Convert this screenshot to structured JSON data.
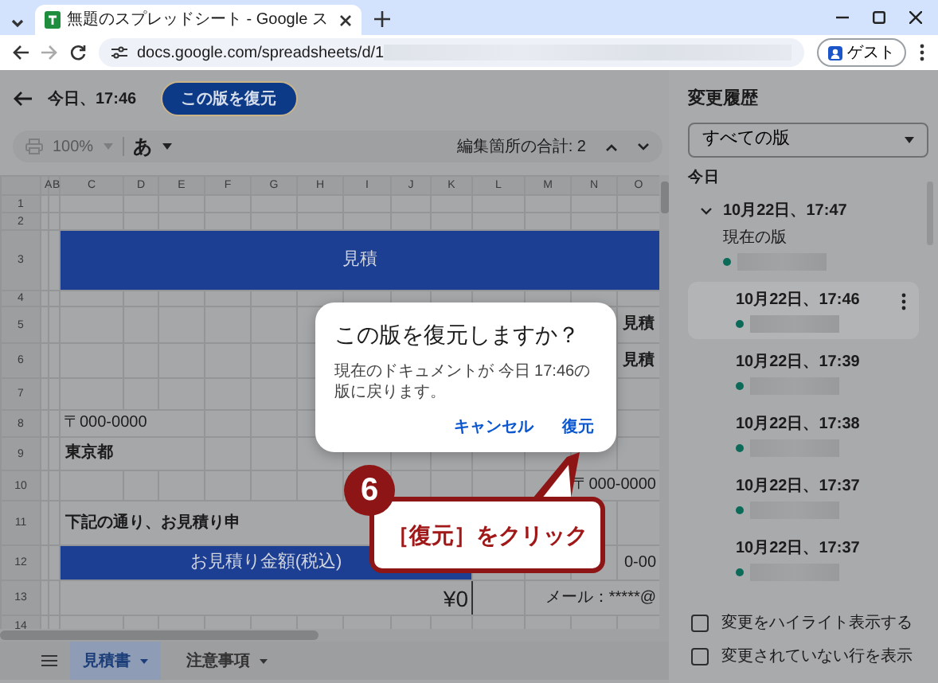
{
  "browser": {
    "tab_title": "無題のスプレッドシート - Google ス",
    "url": "docs.google.com/spreadsheets/d/1",
    "profile": "ゲスト"
  },
  "header": {
    "title": "今日、17:46",
    "restore_button": "この版を復元"
  },
  "toolbar": {
    "zoom": "100%",
    "input_mode": "あ",
    "edit_count": "編集箇所の合計: 2"
  },
  "sheet": {
    "columns": [
      "A",
      "B",
      "C",
      "D",
      "E",
      "F",
      "G",
      "H",
      "I",
      "J",
      "K",
      "L",
      "M",
      "N",
      "O"
    ],
    "rows": [
      {
        "number": "1"
      },
      {
        "number": "2"
      },
      {
        "number": "3",
        "cells": [
          {
            "kind": "banner",
            "text": "見積"
          }
        ]
      },
      {
        "number": "4"
      },
      {
        "number": "5",
        "cells": [
          {
            "kind": "bold",
            "text": "見積"
          }
        ]
      },
      {
        "number": "6",
        "cells": [
          {
            "kind": "bold",
            "text": "見積"
          }
        ]
      },
      {
        "number": "7"
      },
      {
        "number": "8",
        "cells": [
          {
            "kind": "text",
            "text": "〒000-0000"
          }
        ]
      },
      {
        "number": "9",
        "cells": [
          {
            "kind": "bold",
            "text": "東京都"
          }
        ]
      },
      {
        "number": "10",
        "cells": [
          {
            "kind": "right",
            "text": "〒000-0000"
          }
        ]
      },
      {
        "number": "11",
        "cells": [
          {
            "kind": "bold",
            "text": "下記の通り、お見積り申"
          }
        ]
      },
      {
        "number": "12",
        "cells": [
          {
            "kind": "banner",
            "text": "お見積り金額(税込)"
          },
          {
            "kind": "right",
            "text": "0-00"
          }
        ]
      },
      {
        "number": "13",
        "cells": [
          {
            "kind": "total",
            "text": "¥0"
          },
          {
            "kind": "right",
            "text": "メール：*****@"
          }
        ]
      },
      {
        "number": "14"
      }
    ]
  },
  "sheet_tabs": [
    {
      "label": "見積書",
      "selected": true
    },
    {
      "label": "注意事項",
      "selected": false
    }
  ],
  "dialog": {
    "title": "この版を復元しますか？",
    "message": "現在のドキュメントが 今日 17:46の版に戻ります。",
    "buttons": [
      "キャンセル",
      "復元"
    ]
  },
  "callout": {
    "step": "6",
    "text": "［復元］をクリック"
  },
  "history": {
    "title": "変更履歴",
    "filter": "すべての版",
    "section": "今日",
    "versions": [
      {
        "time": "10月22日、17:47",
        "note": "現在の版",
        "expanded": true,
        "selected": false,
        "children": [
          {
            "time": "10月22日、17:46",
            "selected": true
          },
          {
            "time": "10月22日、17:39",
            "selected": false
          },
          {
            "time": "10月22日、17:38",
            "selected": false
          },
          {
            "time": "10月22日、17:37",
            "selected": false
          },
          {
            "time": "10月22日、17:37",
            "selected": false
          }
        ]
      }
    ],
    "options": [
      {
        "label": "変更をハイライト表示する",
        "checked": false
      },
      {
        "label": "変更されていない行を表示",
        "checked": false
      }
    ]
  }
}
